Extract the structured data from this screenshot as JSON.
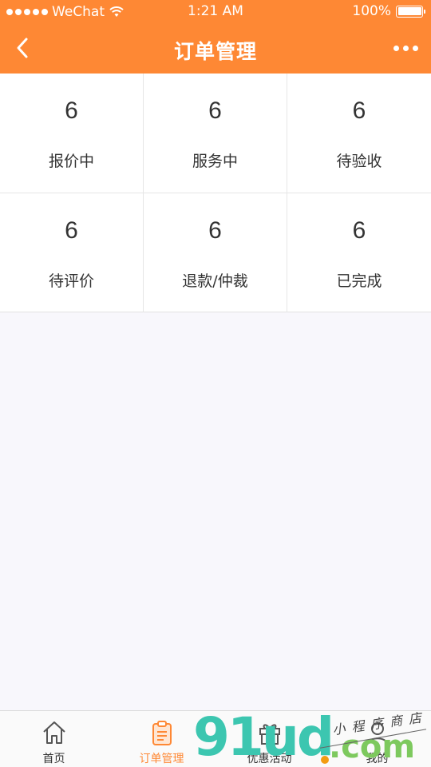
{
  "status_bar": {
    "carrier": "WeChat",
    "time": "1:21 AM",
    "battery": "100%"
  },
  "nav": {
    "title": "订单管理"
  },
  "order_stats": [
    {
      "count": "6",
      "label": "报价中"
    },
    {
      "count": "6",
      "label": "服务中"
    },
    {
      "count": "6",
      "label": "待验收"
    },
    {
      "count": "6",
      "label": "待评价"
    },
    {
      "count": "6",
      "label": "退款/仲裁"
    },
    {
      "count": "6",
      "label": "已完成"
    }
  ],
  "tabbar": {
    "tabs": [
      {
        "label": "首页",
        "icon": "home-icon",
        "active": false
      },
      {
        "label": "订单管理",
        "icon": "clipboard-icon",
        "active": true
      },
      {
        "label": "优惠活动",
        "icon": "gift-icon",
        "active": false
      },
      {
        "label": "我的",
        "icon": "user-icon",
        "active": false
      }
    ]
  },
  "watermark": {
    "brand": "91ud",
    "domain": ".com",
    "tagline": "小程序商店"
  },
  "colors": {
    "accent": "#fe8834",
    "background": "#f8f7fc"
  }
}
